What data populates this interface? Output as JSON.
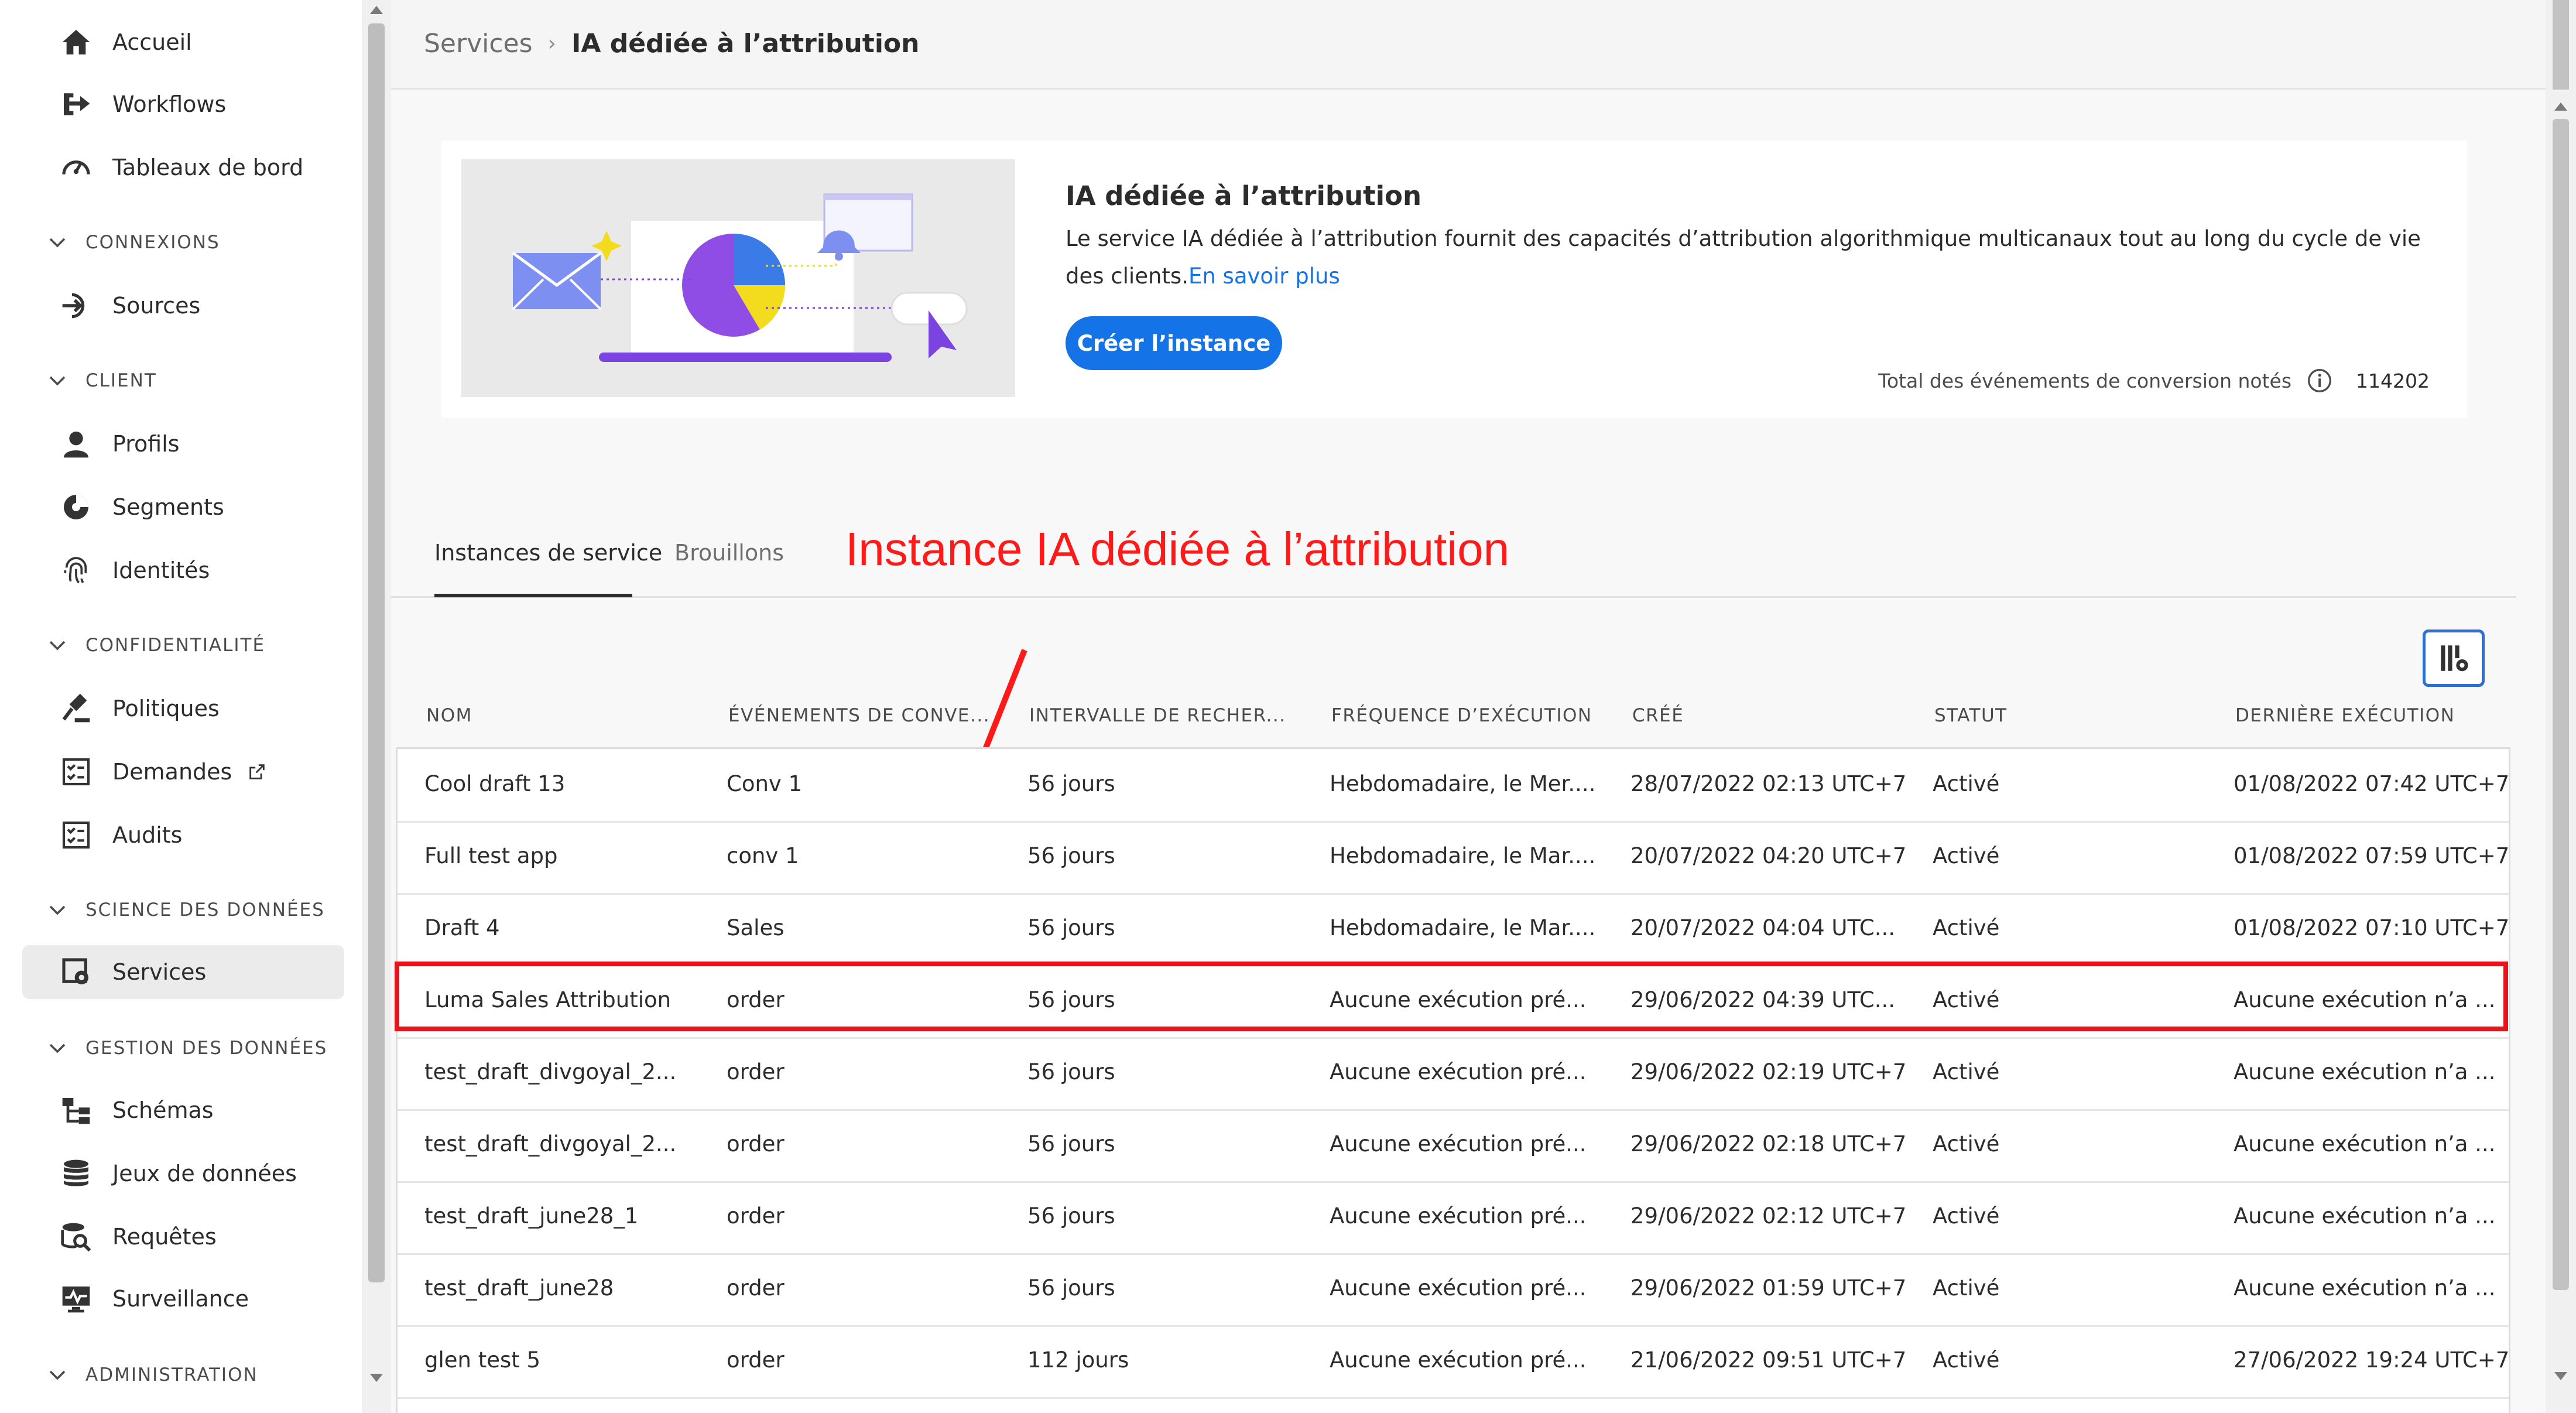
{
  "sidebar": {
    "items": [
      {
        "label": "Accueil",
        "icon": "home-icon"
      },
      {
        "label": "Workflows",
        "icon": "workflow-icon"
      },
      {
        "label": "Tableaux de bord",
        "icon": "dashboard-icon"
      },
      {
        "label": "Sources",
        "icon": "sources-icon"
      },
      {
        "label": "Profils",
        "icon": "user-icon"
      },
      {
        "label": "Segments",
        "icon": "segments-icon"
      },
      {
        "label": "Identités",
        "icon": "fingerprint-icon"
      },
      {
        "label": "Politiques",
        "icon": "gavel-icon"
      },
      {
        "label": "Demandes",
        "icon": "requests-icon"
      },
      {
        "label": "Audits",
        "icon": "audits-icon"
      },
      {
        "label": "Services",
        "icon": "services-icon",
        "active": true
      },
      {
        "label": "Schémas",
        "icon": "schema-icon"
      },
      {
        "label": "Jeux de données",
        "icon": "database-icon"
      },
      {
        "label": "Requêtes",
        "icon": "queries-icon"
      },
      {
        "label": "Surveillance",
        "icon": "monitoring-icon"
      }
    ],
    "sections": [
      "CONNEXIONS",
      "CLIENT",
      "CONFIDENTIALITÉ",
      "SCIENCE DES DONNÉES",
      "GESTION DES DONNÉES",
      "ADMINISTRATION"
    ]
  },
  "breadcrumb": {
    "parent": "Services",
    "separator": "›",
    "current": "IA dédiée à l’attribution"
  },
  "card": {
    "title": "IA dédiée à l’attribution",
    "description": "Le service IA dédiée à l’attribution fournit des capacités d’attribution algorithmique multicanaux tout au long du cycle de vie des clients.",
    "link": "En savoir plus",
    "create_button": "Créer l’instance",
    "stat_label": "Total des événements de conversion notés",
    "stat_value": "114202"
  },
  "tabs": [
    {
      "label": "Instances de service",
      "active": true
    },
    {
      "label": "Brouillons"
    }
  ],
  "annotation": "Instance IA dédiée à l’attribution",
  "table": {
    "headers": [
      "NOM",
      "ÉVÉNEMENTS DE CONVE...",
      "INTERVALLE DE RECHER...",
      "FRÉQUENCE D’EXÉCUTION",
      "CRÉÉ",
      "STATUT",
      "DERNIÈRE EXÉCUTION"
    ],
    "rows": [
      [
        "Cool draft 13",
        "Conv 1",
        "56 jours",
        "Hebdomadaire, le Mer....",
        "28/07/2022 02:13 UTC+7",
        "Activé",
        "01/08/2022 07:42 UTC+7"
      ],
      [
        "Full test app",
        "conv 1",
        "56 jours",
        "Hebdomadaire, le Mar....",
        "20/07/2022 04:20 UTC+7",
        "Activé",
        "01/08/2022 07:59 UTC+7"
      ],
      [
        "Draft 4",
        "Sales",
        "56 jours",
        "Hebdomadaire, le Mar....",
        "20/07/2022 04:04 UTC...",
        "Activé",
        "01/08/2022 07:10 UTC+7"
      ],
      [
        "Luma Sales Attribution",
        "order",
        "56 jours",
        "Aucune exécution pré...",
        "29/06/2022 04:39 UTC...",
        "Activé",
        "Aucune exécution n’a ..."
      ],
      [
        "test_draft_divgoyal_2...",
        "order",
        "56 jours",
        "Aucune exécution pré...",
        "29/06/2022 02:19 UTC+7",
        "Activé",
        "Aucune exécution n’a ..."
      ],
      [
        "test_draft_divgoyal_2...",
        "order",
        "56 jours",
        "Aucune exécution pré...",
        "29/06/2022 02:18 UTC+7",
        "Activé",
        "Aucune exécution n’a ..."
      ],
      [
        "test_draft_june28_1",
        "order",
        "56 jours",
        "Aucune exécution pré...",
        "29/06/2022 02:12 UTC+7",
        "Activé",
        "Aucune exécution n’a ..."
      ],
      [
        "test_draft_june28",
        "order",
        "56 jours",
        "Aucune exécution pré...",
        "29/06/2022 01:59 UTC+7",
        "Activé",
        "Aucune exécution n’a ..."
      ],
      [
        "glen test 5",
        "order",
        "112 jours",
        "Aucune exécution pré...",
        "21/06/2022 09:51 UTC+7",
        "Activé",
        "27/06/2022 19:24 UTC+7"
      ]
    ]
  },
  "colors": {
    "accent": "#1473e6",
    "highlight": "#e8141b",
    "annotation": "#ff1a1a"
  }
}
